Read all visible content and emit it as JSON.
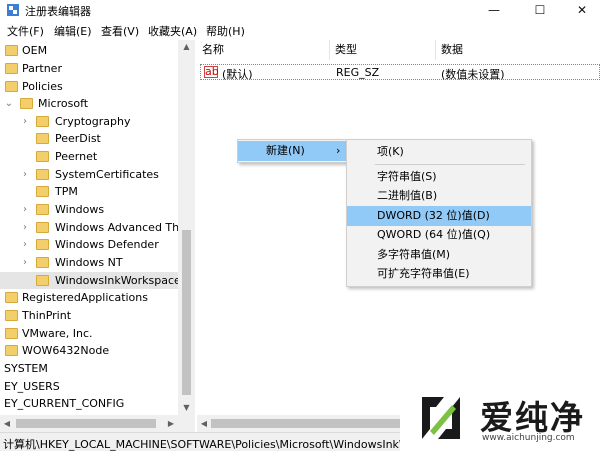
{
  "window": {
    "title": "注册表编辑器",
    "buttons": {
      "minimize": "—",
      "maximize": "☐",
      "close": "✕"
    }
  },
  "menu": [
    "文件(F)",
    "编辑(E)",
    "查看(V)",
    "收藏夹(A)",
    "帮助(H)"
  ],
  "tree": {
    "items": [
      {
        "label": "OEM",
        "chevron": ""
      },
      {
        "label": "Partner",
        "chevron": ""
      },
      {
        "label": "Policies",
        "chevron": ""
      },
      {
        "label": "Microsoft",
        "chevron": "⌄"
      },
      {
        "label": "Cryptography",
        "chevron": "›"
      },
      {
        "label": "PeerDist",
        "chevron": ""
      },
      {
        "label": "Peernet",
        "chevron": ""
      },
      {
        "label": "SystemCertificates",
        "chevron": "›"
      },
      {
        "label": "TPM",
        "chevron": ""
      },
      {
        "label": "Windows",
        "chevron": "›"
      },
      {
        "label": "Windows Advanced Thr",
        "chevron": "›"
      },
      {
        "label": "Windows Defender",
        "chevron": "›"
      },
      {
        "label": "Windows NT",
        "chevron": "›"
      },
      {
        "label": "WindowsInkWorkspace",
        "chevron": ""
      },
      {
        "label": "RegisteredApplications",
        "chevron": ""
      },
      {
        "label": "ThinPrint",
        "chevron": ""
      },
      {
        "label": "VMware, Inc.",
        "chevron": ""
      },
      {
        "label": "WOW6432Node",
        "chevron": ""
      }
    ],
    "roots": [
      "SYSTEM",
      "EY_USERS",
      "EY_CURRENT_CONFIG"
    ]
  },
  "values_pane": {
    "columns": [
      "名称",
      "类型",
      "数据"
    ],
    "rows": [
      {
        "icon": "ab",
        "name": "(默认)",
        "type": "REG_SZ",
        "data": "(数值未设置)"
      }
    ]
  },
  "context_menu": {
    "new_label": "新建(N)",
    "arrow": "›",
    "submenu": [
      "项(K)",
      "字符串值(S)",
      "二进制值(B)",
      "DWORD (32 位)值(D)",
      "QWORD (64 位)值(Q)",
      "多字符串值(M)",
      "可扩充字符串值(E)"
    ]
  },
  "status": "计算机\\HKEY_LOCAL_MACHINE\\SOFTWARE\\Policies\\Microsoft\\WindowsInkWo",
  "watermark": {
    "brand": "爱纯净",
    "url": "www.aichunjing.com"
  },
  "colors": {
    "highlight": "#91c9f7",
    "folder": "#f3cf6b",
    "logo_green": "#7cc242"
  }
}
